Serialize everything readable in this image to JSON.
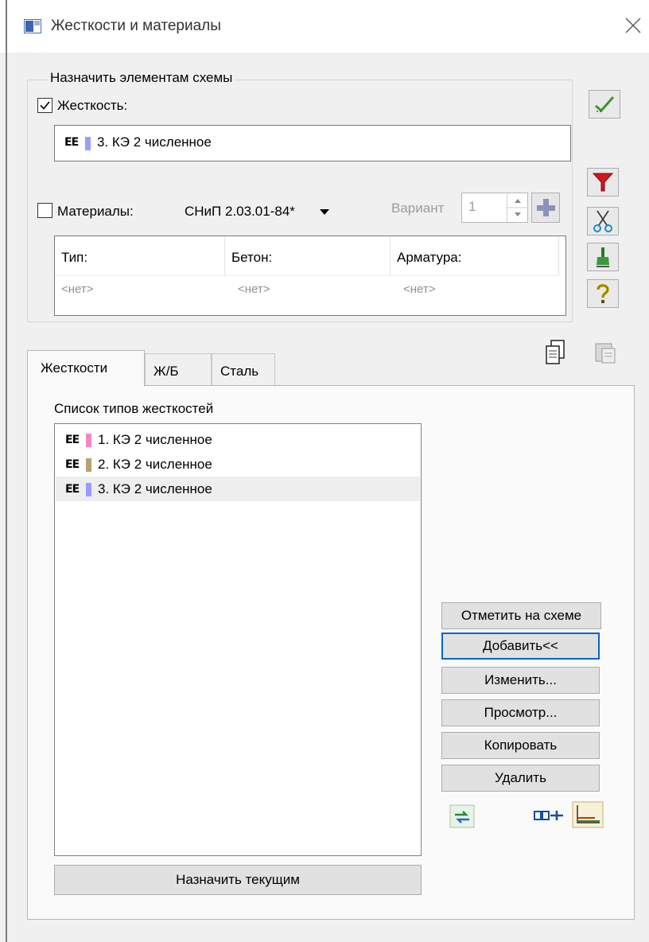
{
  "window": {
    "title": "Жесткости и материалы",
    "icon": "window-app-icon",
    "close_icon": "close-icon"
  },
  "assign_group": {
    "title": "Назначить элементам схемы",
    "stiffness": {
      "checked": true,
      "label": "Жесткость:",
      "value": {
        "prefix": "EE",
        "swatch_color": "#9c9cff",
        "text": "3. КЭ 2 численное"
      }
    },
    "materials": {
      "checked": false,
      "label": "Материалы:",
      "norm": "СНиП 2.03.01-84*",
      "variant_label": "Вариант",
      "variant_value": "1",
      "table": {
        "headers": [
          "Тип:",
          "Бетон:",
          "Арматура:"
        ],
        "row": [
          "<нет>",
          "<нет>",
          "<нет>"
        ]
      }
    }
  },
  "toolbar_icons": [
    "check-icon",
    "filter-icon",
    "scissors-icon",
    "brush-icon",
    "help-icon",
    "copy-document-icon",
    "paste-document-icon"
  ],
  "tabs": [
    {
      "label": "Жесткости",
      "active": true
    },
    {
      "label": "Ж/Б",
      "active": false
    },
    {
      "label": "Сталь",
      "active": false
    }
  ],
  "stiffness_list": {
    "title": "Список типов жесткостей",
    "items": [
      {
        "prefix": "EE",
        "swatch_color": "#f088c8",
        "text": "1. КЭ 2 численное",
        "selected": false
      },
      {
        "prefix": "EE",
        "swatch_color": "#b8a070",
        "text": "2. КЭ 2 численное",
        "selected": false
      },
      {
        "prefix": "EE",
        "swatch_color": "#9c9cff",
        "text": "3. КЭ 2 численное",
        "selected": true
      }
    ]
  },
  "side_buttons": {
    "mark": "Отметить на схеме",
    "add": "Добавить<<",
    "edit": "Изменить...",
    "view": "Просмотр...",
    "copy": "Копировать",
    "delete": "Удалить"
  },
  "assign_current": "Назначить текущим",
  "colors": {
    "accent_blue": "#0a64c8",
    "green_check": "#3a9a20",
    "filter_red": "#d01820"
  }
}
